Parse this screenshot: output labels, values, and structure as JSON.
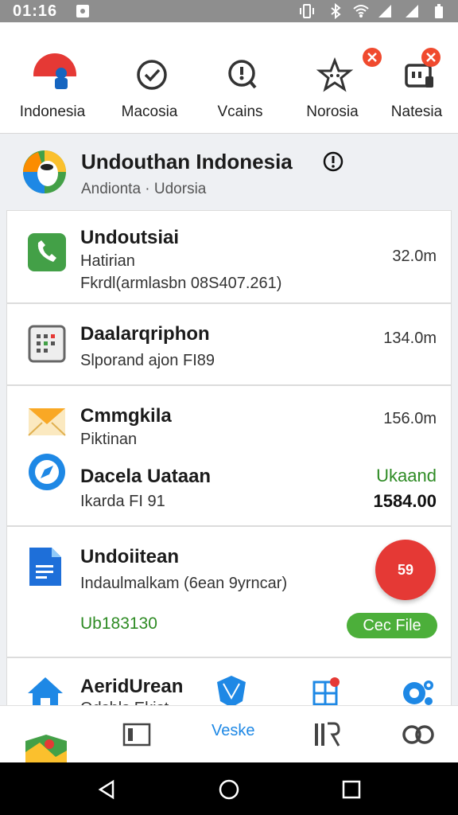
{
  "status_bar": {
    "time": "01:16"
  },
  "tabs": [
    {
      "label": "Indonesia"
    },
    {
      "label": "Macosia"
    },
    {
      "label": "Vcains"
    },
    {
      "label": "Norosia"
    },
    {
      "label": "Natesia"
    }
  ],
  "header": {
    "title": "Undouthan Indonesia",
    "subtitle": "Andionta · Udorsia"
  },
  "list": [
    {
      "title": "Undoutsiai",
      "line2": "Hatirian",
      "line3": "Fkrdl(armlasbn 08S407.261)",
      "right": "32.0m",
      "icon": "phone-icon"
    },
    {
      "title": "Daalarqriphon",
      "line2": "Slporand ajon FI89",
      "right": "134.0m",
      "icon": "calendar-icon"
    },
    {
      "title": "Cmmgkila",
      "line2": "Piktinan",
      "right": "156.0m",
      "icon": "mail-icon",
      "sub_title": "Dacela Uataan",
      "sub_line2": "Ikarda FI 91",
      "sub_right_status": "Ukaand",
      "sub_right_value": "1584.00",
      "sub_icon": "compass-icon"
    },
    {
      "title": "Undoiitean",
      "line2": "Indaulmalkam (6ean 9yrncar)",
      "line3": "Ub183130",
      "fab_label": "59",
      "pill_label": "Cec File",
      "icon": "document-icon"
    },
    {
      "title": "AeridUrean",
      "line2": "Odsbls Ekist",
      "icon": "home-icon"
    }
  ],
  "bottom_nav": {
    "active_label": "Veske"
  },
  "colors": {
    "accent": "#1e88e5",
    "green": "#2e8b24",
    "red": "#e53935"
  }
}
